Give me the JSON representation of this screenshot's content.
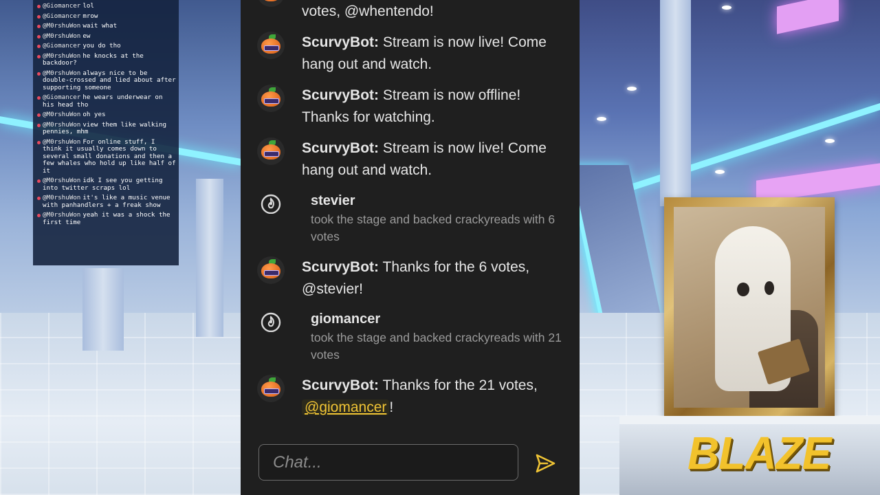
{
  "chat_log": [
    {
      "user": "@Giomancer",
      "text": "lol"
    },
    {
      "user": "@Giomancer",
      "text": "mrow"
    },
    {
      "user": "@M0rshuWon",
      "text": "wait what"
    },
    {
      "user": "@M0rshuWon",
      "text": "ew"
    },
    {
      "user": "@Giomancer",
      "text": "you do tho"
    },
    {
      "user": "@M0rshuWon",
      "text": "he knocks at the backdoor?"
    },
    {
      "user": "@M0rshuWon",
      "text": "always nice to be double-crossed and lied about after supporting someone"
    },
    {
      "user": "@Giomancer",
      "text": "he wears underwear on his head tho"
    },
    {
      "user": "@M0rshuWon",
      "text": "oh yes"
    },
    {
      "user": "@M0rshuWon",
      "text": "view them like walking pennies, mhm"
    },
    {
      "user": "@M0rshuWon",
      "text": "For online stuff, I think it usually comes down to several small donations and then a few whales who hold up like half of it"
    },
    {
      "user": "@M0rshuWon",
      "text": "idk I see you getting into twitter scraps lol"
    },
    {
      "user": "@M0rshuWon",
      "text": "it's like a music venue with panhandlers + a freak show"
    },
    {
      "user": "@M0rshuWon",
      "text": "yeah it was a shock the first time"
    }
  ],
  "chat": {
    "messages": [
      {
        "kind": "bot",
        "name": "",
        "text": "votes, @whentendo!"
      },
      {
        "kind": "bot",
        "name": "ScurvyBot:",
        "text": "Stream is now live! Come hang out and watch."
      },
      {
        "kind": "bot",
        "name": "ScurvyBot:",
        "text": "Stream is now offline! Thanks for watching."
      },
      {
        "kind": "bot",
        "name": "ScurvyBot:",
        "text": "Stream is now live! Come hang out and watch."
      },
      {
        "kind": "stage",
        "user": "stevier",
        "desc": "took the stage and backed crackyreads with 6 votes"
      },
      {
        "kind": "bot",
        "name": "ScurvyBot:",
        "text": "Thanks for the 6 votes, @stevier!"
      },
      {
        "kind": "stage",
        "user": "giomancer",
        "desc": "took the stage and backed crackyreads with 21 votes"
      },
      {
        "kind": "bot-mention",
        "name": "ScurvyBot:",
        "text_before": "Thanks for the 21 votes,",
        "mention": "@giomancer",
        "text_after": "!"
      }
    ],
    "input_placeholder": "Chat...",
    "send_icon": "send-arrow-icon"
  },
  "overlay": {
    "streamer_name": "BLAZE"
  },
  "colors": {
    "chat_bg": "#1f1f1f",
    "mention": "#f0c435",
    "log_dot": "#e84a5f",
    "name_plate": "#f2c22c"
  }
}
